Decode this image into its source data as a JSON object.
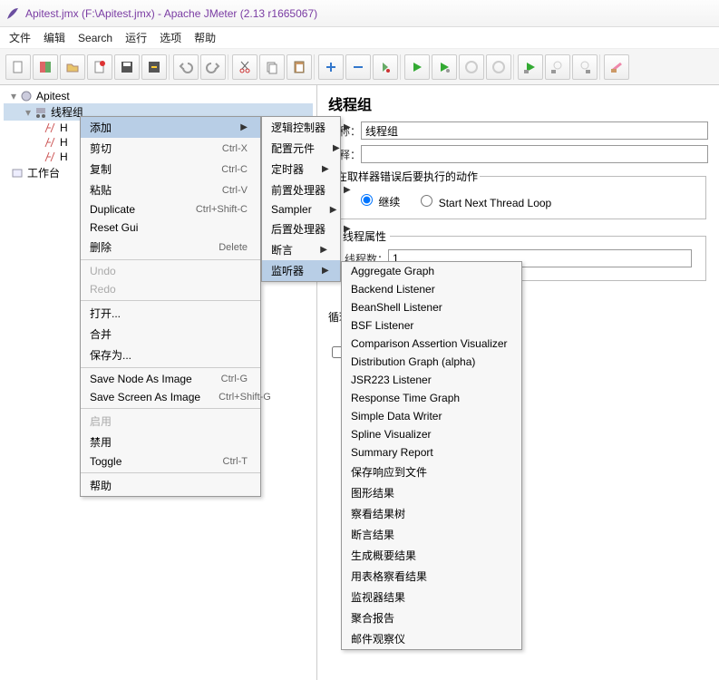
{
  "title": "Apitest.jmx (F:\\Apitest.jmx) - Apache JMeter (2.13 r1665067)",
  "menubar": {
    "file": "文件",
    "edit": "编辑",
    "search": "Search",
    "run": "运行",
    "options": "选项",
    "help": "帮助"
  },
  "tree": {
    "root": "Apitest",
    "threadGroup": "线程组",
    "req1": "H",
    "req2": "H",
    "req3": "H",
    "workbench": "工作台"
  },
  "panel": {
    "title": "线程组",
    "nameLabel": "名称：",
    "nameValue": "线程组",
    "commentLabel": "注释：",
    "samplerErrorLabel": "在取样器错误后要执行的动作",
    "continue": "继续",
    "startNext": "Start Next Thread Loop",
    "threadProps": "线程属性",
    "threadsLabel": "线程数：",
    "threadsValue": "1",
    "loopLabel": "循环次数"
  },
  "ctx1": [
    {
      "label": "添加",
      "arrow": true,
      "sel": true
    },
    {
      "label": "剪切",
      "sc": "Ctrl-X"
    },
    {
      "label": "复制",
      "sc": "Ctrl-C"
    },
    {
      "label": "粘贴",
      "sc": "Ctrl-V"
    },
    {
      "label": "Duplicate",
      "sc": "Ctrl+Shift-C"
    },
    {
      "label": "Reset Gui"
    },
    {
      "label": "删除",
      "sc": "Delete"
    },
    {
      "sep": true
    },
    {
      "label": "Undo",
      "dis": true
    },
    {
      "label": "Redo",
      "dis": true
    },
    {
      "sep": true
    },
    {
      "label": "打开..."
    },
    {
      "label": "合并"
    },
    {
      "label": "保存为..."
    },
    {
      "sep": true
    },
    {
      "label": "Save Node As Image",
      "sc": "Ctrl-G"
    },
    {
      "label": "Save Screen As Image",
      "sc": "Ctrl+Shift-G"
    },
    {
      "sep": true
    },
    {
      "label": "启用",
      "dis": true
    },
    {
      "label": "禁用"
    },
    {
      "label": "Toggle",
      "sc": "Ctrl-T"
    },
    {
      "sep": true
    },
    {
      "label": "帮助"
    }
  ],
  "ctx2": [
    {
      "label": "逻辑控制器",
      "arrow": true
    },
    {
      "label": "配置元件",
      "arrow": true
    },
    {
      "label": "定时器",
      "arrow": true
    },
    {
      "label": "前置处理器",
      "arrow": true
    },
    {
      "label": "Sampler",
      "arrow": true
    },
    {
      "label": "后置处理器",
      "arrow": true
    },
    {
      "label": "断言",
      "arrow": true
    },
    {
      "label": "监听器",
      "arrow": true,
      "sel": true
    }
  ],
  "ctx3": [
    {
      "label": "Aggregate Graph"
    },
    {
      "label": "Backend Listener"
    },
    {
      "label": "BeanShell Listener"
    },
    {
      "label": "BSF Listener"
    },
    {
      "label": "Comparison Assertion Visualizer"
    },
    {
      "label": "Distribution Graph (alpha)"
    },
    {
      "label": "JSR223 Listener"
    },
    {
      "label": "Response Time Graph"
    },
    {
      "label": "Simple Data Writer"
    },
    {
      "label": "Spline Visualizer"
    },
    {
      "label": "Summary Report"
    },
    {
      "label": "保存响应到文件"
    },
    {
      "label": "图形结果"
    },
    {
      "label": "察看结果树"
    },
    {
      "label": "断言结果"
    },
    {
      "label": "生成概要结果"
    },
    {
      "label": "用表格察看结果"
    },
    {
      "label": "监视器结果"
    },
    {
      "label": "聚合报告"
    },
    {
      "label": "邮件观察仪"
    }
  ]
}
